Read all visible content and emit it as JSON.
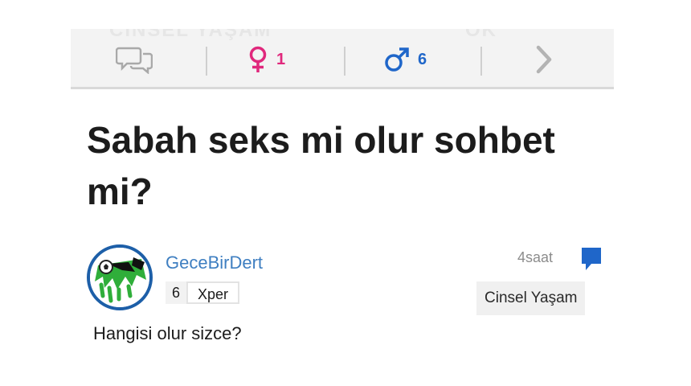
{
  "stats_bar": {
    "watermark_left": "CİNSEL YAŞAM",
    "watermark_right": "OK",
    "comments_icon": "speech-bubbles-icon",
    "female_count": "1",
    "male_count": "6",
    "next_icon": "chevron-right-icon"
  },
  "question": {
    "title": "Sabah seks mi olur sohbet mi?",
    "body": "Hangisi olur sizce?"
  },
  "author": {
    "username": "GeceBirDert",
    "level": "6",
    "level_label": "Xper",
    "avatar_icon": "soccer-ball-avatar-icon"
  },
  "meta": {
    "time": "4saat",
    "category": "Cinsel Yaşam",
    "chat_icon": "chat-bubble-icon"
  },
  "colors": {
    "female": "#e0287c",
    "male": "#1f66c9",
    "username": "#3f7fc1",
    "chat_icon": "#1f66c9",
    "bar_bg": "#f3f3f3"
  }
}
